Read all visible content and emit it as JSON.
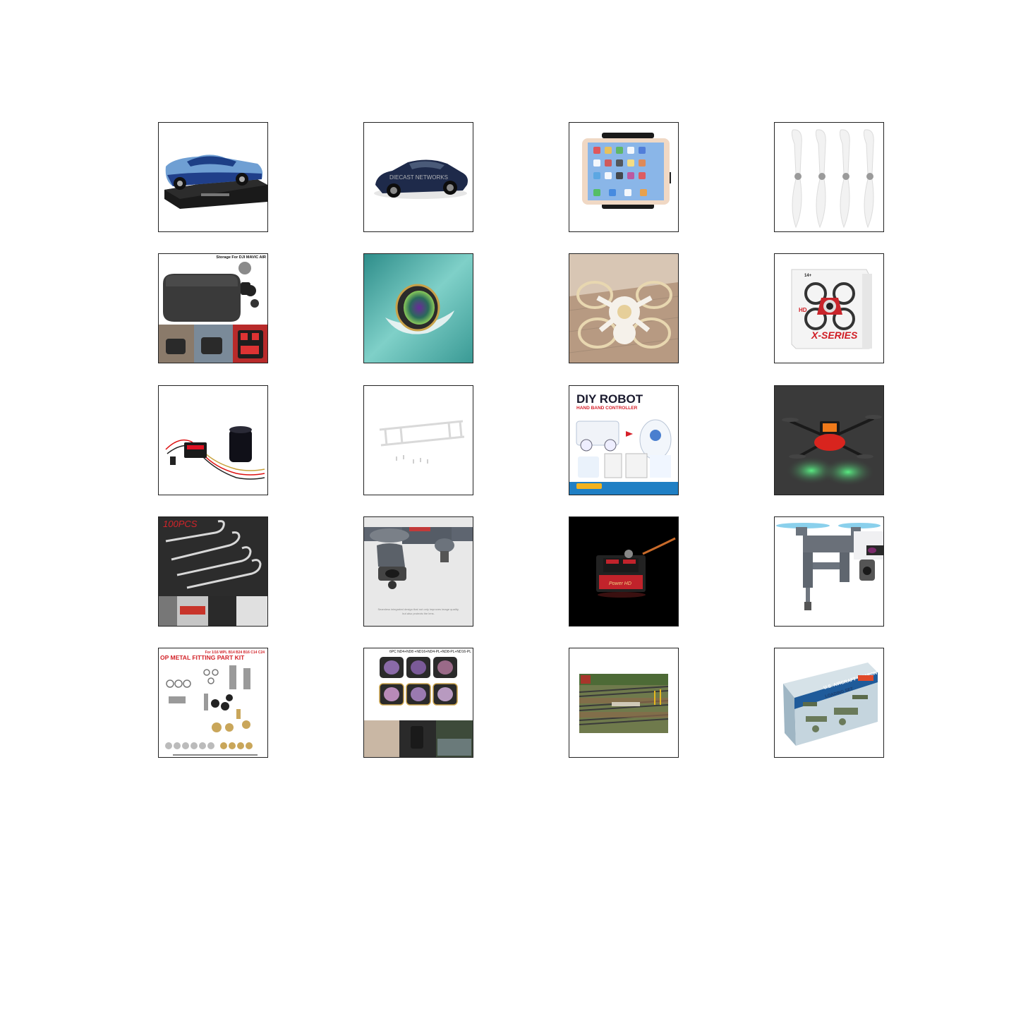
{
  "products": [
    {
      "icon": "blue-convertible-model-car-image"
    },
    {
      "icon": "dark-blue-coupe-model-car-image",
      "overlay_text": "DIECAST NETWORKS"
    },
    {
      "icon": "tablet-holder-mount-image"
    },
    {
      "icon": "white-propellers-image"
    },
    {
      "icon": "drone-storage-case-image",
      "title": "Storage For DJI MAVIC AIR"
    },
    {
      "icon": "lens-filter-image"
    },
    {
      "icon": "white-mini-quadcopter-image"
    },
    {
      "icon": "x-series-drone-box-image",
      "box_brand": "X-SERIES",
      "box_badge": "HD",
      "box_age": "14+"
    },
    {
      "icon": "brushless-motor-esc-image"
    },
    {
      "icon": "clear-landing-gear-image"
    },
    {
      "icon": "diy-robot-kit-image",
      "title": "DIY ROBOT",
      "subtitle": "HAND BAND CONTROLLER"
    },
    {
      "icon": "led-folding-drone-image"
    },
    {
      "icon": "body-clips-image",
      "label": "100PCS"
    },
    {
      "icon": "drone-gimbal-guard-image",
      "caption_line1": "Seamless integrated design that not only improves image quality,",
      "caption_line2": "but also protects the lens."
    },
    {
      "icon": "digital-servo-image"
    },
    {
      "icon": "landing-gear-extension-image"
    },
    {
      "icon": "metal-fitting-part-kit-image",
      "top_label": "For 1/16 WPL B14 B24 B16 C14 C24",
      "title": "OP METAL FITTING PART KIT"
    },
    {
      "icon": "nd-filter-set-image",
      "title": "6PC ND4+ND8 +ND16+ND4-PL+ND8-PL+ND16-PL"
    },
    {
      "icon": "model-railway-scenery-image"
    },
    {
      "icon": "aircraft-weapon-loading-set-box-image",
      "box_title": "U.S. AIRCRAFT WEAPON",
      "box_subtitle": "LOADING SET"
    }
  ]
}
